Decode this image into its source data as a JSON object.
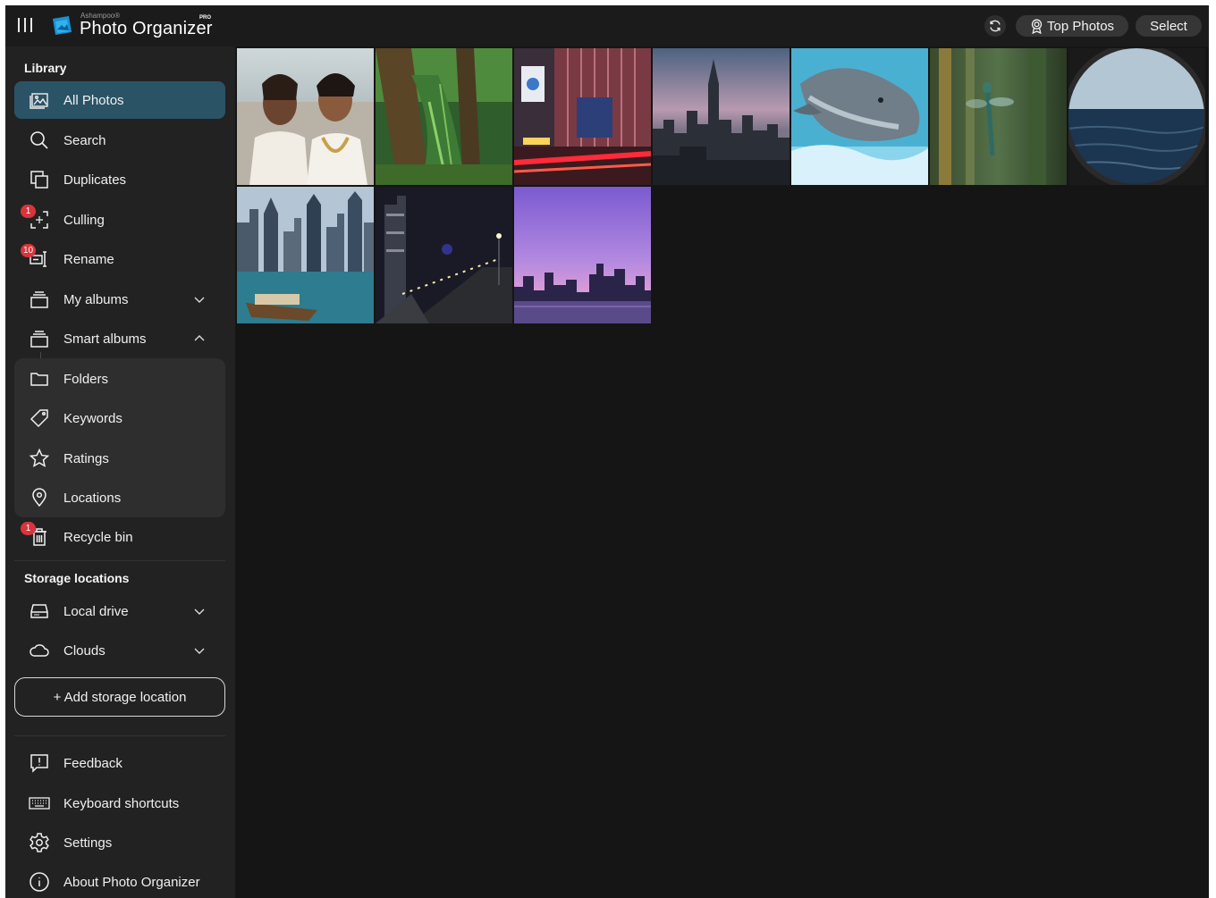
{
  "titlebar": {
    "brand_small": "Ashampoo®",
    "app_title": "Photo Organizer",
    "edition": "PRO",
    "top_photos_label": "Top Photos",
    "select_label": "Select"
  },
  "sidebar": {
    "library_title": "Library",
    "storage_title": "Storage locations",
    "items": [
      {
        "label": "All Photos",
        "icon": "photos-icon"
      },
      {
        "label": "Search",
        "icon": "search-icon"
      },
      {
        "label": "Duplicates",
        "icon": "duplicates-icon"
      },
      {
        "label": "Culling",
        "icon": "culling-icon",
        "badge": "1"
      },
      {
        "label": "Rename",
        "icon": "rename-icon",
        "badge": "10"
      },
      {
        "label": "My albums",
        "icon": "album-icon"
      },
      {
        "label": "Smart albums",
        "icon": "smart-album-icon"
      },
      {
        "label": "Folders",
        "icon": "folder-icon"
      },
      {
        "label": "Keywords",
        "icon": "tag-icon"
      },
      {
        "label": "Ratings",
        "icon": "star-icon"
      },
      {
        "label": "Locations",
        "icon": "location-pin-icon"
      },
      {
        "label": "Recycle bin",
        "icon": "trash-icon",
        "badge": "1"
      }
    ],
    "storage_items": [
      {
        "label": "Local drive",
        "icon": "drive-icon"
      },
      {
        "label": "Clouds",
        "icon": "cloud-icon"
      }
    ],
    "add_storage_label": "+ Add storage location",
    "footer_items": [
      {
        "label": "Feedback",
        "icon": "feedback-icon"
      },
      {
        "label": "Keyboard shortcuts",
        "icon": "keyboard-icon"
      },
      {
        "label": "Settings",
        "icon": "gear-icon"
      },
      {
        "label": "About Photo Organizer",
        "icon": "info-icon"
      }
    ]
  },
  "colors": {
    "background": "#151515",
    "sidebar": "#222222",
    "active_item": "#2b5366",
    "badge": "#d9343c"
  },
  "gallery": {
    "photos": [
      "couple-portrait-photo",
      "forest-trees-photo",
      "city-neon-street-photo",
      "skyline-dusk-photo",
      "dolphin-photo",
      "dragonfly-photo",
      "ocean-porthole-photo",
      "harbor-skyscrapers-photo",
      "night-promenade-photo",
      "purple-skyline-photo"
    ]
  }
}
